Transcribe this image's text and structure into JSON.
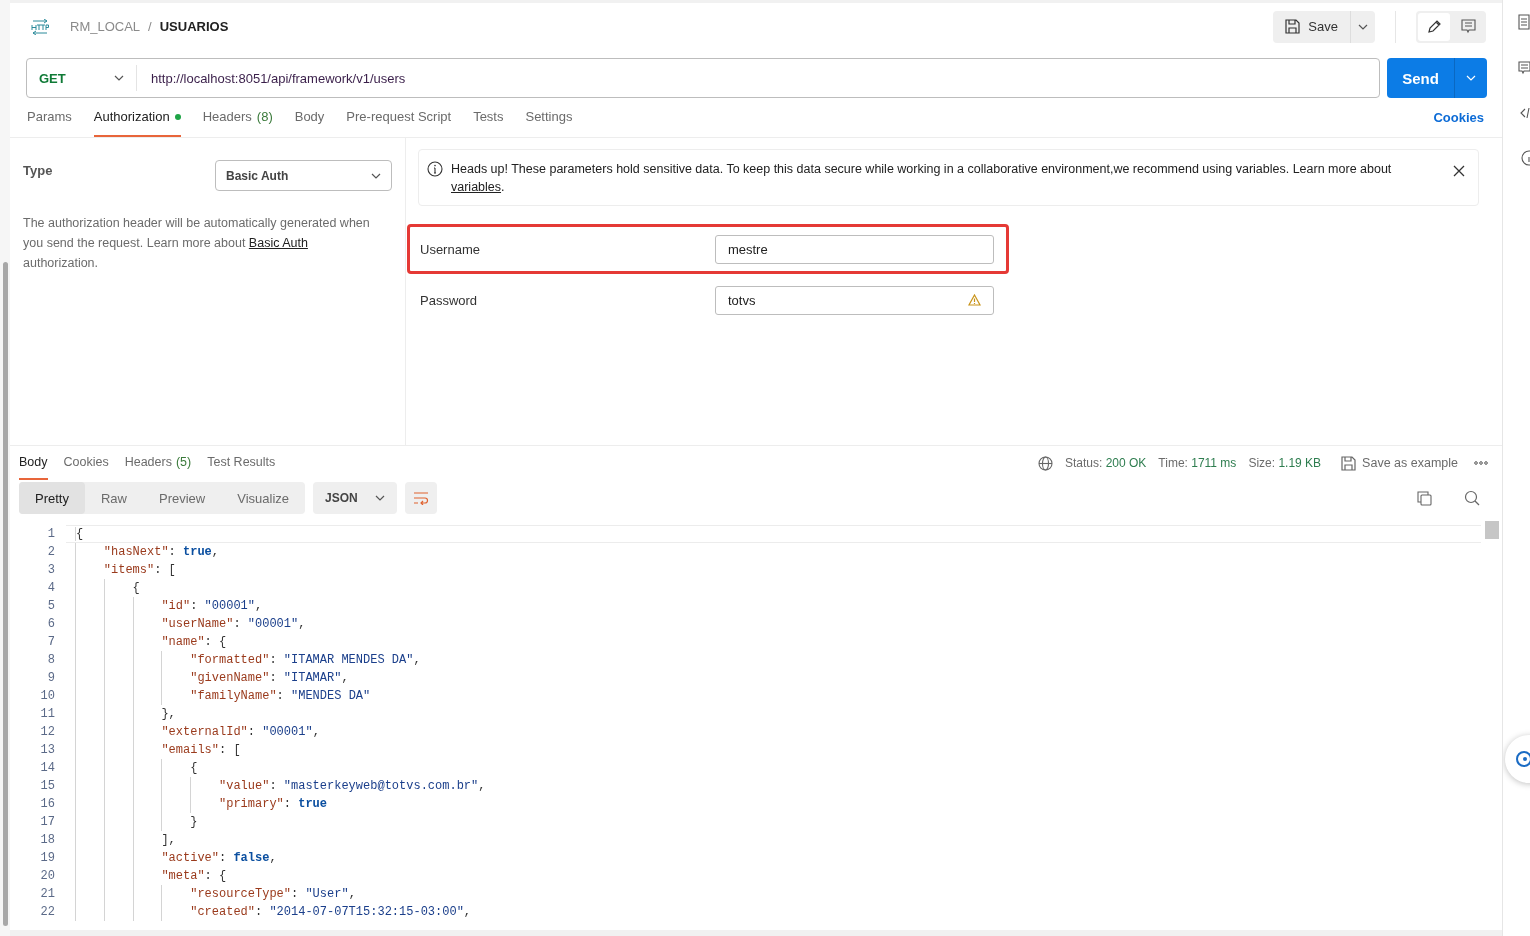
{
  "breadcrumb": {
    "collection": "RM_LOCAL",
    "separator": "/",
    "request": "USUARIOS"
  },
  "header_actions": {
    "save": "Save",
    "modes": [
      {
        "kind": "edit",
        "selected": true
      },
      {
        "kind": "comment",
        "selected": false
      }
    ]
  },
  "request": {
    "method": "GET",
    "url": "http://localhost:8051/api/framework/v1/users",
    "send": "Send"
  },
  "request_tabs": [
    {
      "label": "Params",
      "selected": false
    },
    {
      "label": "Authorization",
      "selected": true,
      "dot": true
    },
    {
      "label": "Headers",
      "count": "(8)",
      "selected": false
    },
    {
      "label": "Body",
      "selected": false
    },
    {
      "label": "Pre-request Script",
      "selected": false
    },
    {
      "label": "Tests",
      "selected": false
    },
    {
      "label": "Settings",
      "selected": false
    }
  ],
  "cookies_link": "Cookies",
  "auth": {
    "type_label": "Type",
    "type_value": "Basic Auth",
    "description": "The authorization header will be automatically generated when you send the request. Learn more about ",
    "description_link": "Basic Auth",
    "description_end": " authorization.",
    "banner": {
      "text": "Heads up! These parameters hold sensitive data. To keep this data secure while working in a collaborative environment,we recommend using variables. Learn more about ",
      "link": "variables",
      "end": "."
    },
    "fields": [
      {
        "label": "Username",
        "value": "mestre",
        "highlighted": true,
        "warning": false
      },
      {
        "label": "Password",
        "value": "totvs",
        "highlighted": false,
        "warning": true
      }
    ]
  },
  "response_tabs": [
    {
      "label": "Body",
      "selected": true
    },
    {
      "label": "Cookies",
      "selected": false
    },
    {
      "label": "Headers",
      "count": "(5)",
      "selected": false
    },
    {
      "label": "Test Results",
      "selected": false
    }
  ],
  "metrics": [
    {
      "label": "Status:",
      "value": "200 OK"
    },
    {
      "label": "Time:",
      "value": "1711 ms"
    },
    {
      "label": "Size:",
      "value": "1.19 KB"
    }
  ],
  "save_example": "Save as example",
  "view_modes": [
    {
      "label": "Pretty",
      "selected": true
    },
    {
      "label": "Raw",
      "selected": false
    },
    {
      "label": "Preview",
      "selected": false
    },
    {
      "label": "Visualize",
      "selected": false
    }
  ],
  "format": "JSON",
  "code": [
    {
      "num": "1",
      "tokens": [
        {
          "kind": "punct",
          "text": "{"
        }
      ],
      "children": [
        {
          "num": "2",
          "tokens": [
            {
              "kind": "key",
              "text": "\"hasNext\""
            },
            {
              "kind": "punct",
              "text": ": "
            },
            {
              "kind": "literal",
              "text": "true"
            },
            {
              "kind": "punct",
              "text": ","
            }
          ]
        },
        {
          "num": "3",
          "tokens": [
            {
              "kind": "key",
              "text": "\"items\""
            },
            {
              "kind": "punct",
              "text": ": ["
            }
          ],
          "children": [
            {
              "num": "4",
              "tokens": [
                {
                  "kind": "punct",
                  "text": "{"
                }
              ],
              "children": [
                {
                  "num": "5",
                  "tokens": [
                    {
                      "kind": "key",
                      "text": "\"id\""
                    },
                    {
                      "kind": "punct",
                      "text": ": "
                    },
                    {
                      "kind": "string",
                      "text": "\"00001\""
                    },
                    {
                      "kind": "punct",
                      "text": ","
                    }
                  ]
                },
                {
                  "num": "6",
                  "tokens": [
                    {
                      "kind": "key",
                      "text": "\"userName\""
                    },
                    {
                      "kind": "punct",
                      "text": ": "
                    },
                    {
                      "kind": "string",
                      "text": "\"00001\""
                    },
                    {
                      "kind": "punct",
                      "text": ","
                    }
                  ]
                },
                {
                  "num": "7",
                  "tokens": [
                    {
                      "kind": "key",
                      "text": "\"name\""
                    },
                    {
                      "kind": "punct",
                      "text": ": {"
                    }
                  ],
                  "children": [
                    {
                      "num": "8",
                      "tokens": [
                        {
                          "kind": "key",
                          "text": "\"formatted\""
                        },
                        {
                          "kind": "punct",
                          "text": ": "
                        },
                        {
                          "kind": "string",
                          "text": "\"ITAMAR MENDES DA\""
                        },
                        {
                          "kind": "punct",
                          "text": ","
                        }
                      ]
                    },
                    {
                      "num": "9",
                      "tokens": [
                        {
                          "kind": "key",
                          "text": "\"givenName\""
                        },
                        {
                          "kind": "punct",
                          "text": ": "
                        },
                        {
                          "kind": "string",
                          "text": "\"ITAMAR\""
                        },
                        {
                          "kind": "punct",
                          "text": ","
                        }
                      ]
                    },
                    {
                      "num": "10",
                      "tokens": [
                        {
                          "kind": "key",
                          "text": "\"familyName\""
                        },
                        {
                          "kind": "punct",
                          "text": ": "
                        },
                        {
                          "kind": "string",
                          "text": "\"MENDES DA\""
                        }
                      ]
                    }
                  ]
                },
                {
                  "num": "11",
                  "tokens": [
                    {
                      "kind": "punct",
                      "text": "},"
                    }
                  ]
                },
                {
                  "num": "12",
                  "tokens": [
                    {
                      "kind": "key",
                      "text": "\"externalId\""
                    },
                    {
                      "kind": "punct",
                      "text": ": "
                    },
                    {
                      "kind": "string",
                      "text": "\"00001\""
                    },
                    {
                      "kind": "punct",
                      "text": ","
                    }
                  ]
                },
                {
                  "num": "13",
                  "tokens": [
                    {
                      "kind": "key",
                      "text": "\"emails\""
                    },
                    {
                      "kind": "punct",
                      "text": ": ["
                    }
                  ],
                  "children": [
                    {
                      "num": "14",
                      "tokens": [
                        {
                          "kind": "punct",
                          "text": "{"
                        }
                      ],
                      "children": [
                        {
                          "num": "15",
                          "tokens": [
                            {
                              "kind": "key",
                              "text": "\"value\""
                            },
                            {
                              "kind": "punct",
                              "text": ": "
                            },
                            {
                              "kind": "string",
                              "text": "\"masterkeyweb@totvs.com.br\""
                            },
                            {
                              "kind": "punct",
                              "text": ","
                            }
                          ]
                        },
                        {
                          "num": "16",
                          "tokens": [
                            {
                              "kind": "key",
                              "text": "\"primary\""
                            },
                            {
                              "kind": "punct",
                              "text": ": "
                            },
                            {
                              "kind": "literal",
                              "text": "true"
                            }
                          ]
                        }
                      ]
                    },
                    {
                      "num": "17",
                      "tokens": [
                        {
                          "kind": "punct",
                          "text": "}"
                        }
                      ]
                    }
                  ]
                },
                {
                  "num": "18",
                  "tokens": [
                    {
                      "kind": "punct",
                      "text": "],"
                    }
                  ]
                },
                {
                  "num": "19",
                  "tokens": [
                    {
                      "kind": "key",
                      "text": "\"active\""
                    },
                    {
                      "kind": "punct",
                      "text": ": "
                    },
                    {
                      "kind": "literal",
                      "text": "false"
                    },
                    {
                      "kind": "punct",
                      "text": ","
                    }
                  ]
                },
                {
                  "num": "20",
                  "tokens": [
                    {
                      "kind": "key",
                      "text": "\"meta\""
                    },
                    {
                      "kind": "punct",
                      "text": ": {"
                    }
                  ],
                  "children": [
                    {
                      "num": "21",
                      "tokens": [
                        {
                          "kind": "key",
                          "text": "\"resourceType\""
                        },
                        {
                          "kind": "punct",
                          "text": ": "
                        },
                        {
                          "kind": "string",
                          "text": "\"User\""
                        },
                        {
                          "kind": "punct",
                          "text": ","
                        }
                      ]
                    },
                    {
                      "num": "22",
                      "tokens": [
                        {
                          "kind": "key",
                          "text": "\"created\""
                        },
                        {
                          "kind": "punct",
                          "text": ": "
                        },
                        {
                          "kind": "string",
                          "text": "\"2014-07-07T15:32:15-03:00\""
                        },
                        {
                          "kind": "punct",
                          "text": ","
                        }
                      ]
                    }
                  ]
                }
              ]
            }
          ]
        }
      ]
    }
  ]
}
